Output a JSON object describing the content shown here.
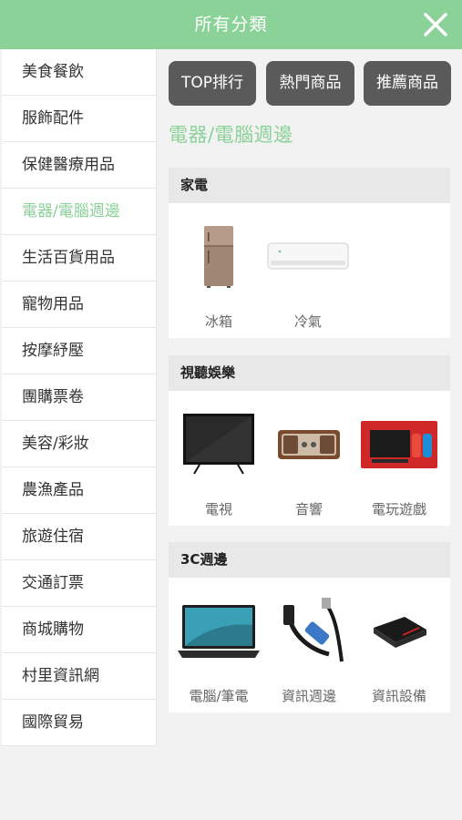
{
  "header": {
    "title": "所有分類",
    "close_icon": "close-icon"
  },
  "sidebar": {
    "items": [
      {
        "label": "美食餐飲"
      },
      {
        "label": "服飾配件"
      },
      {
        "label": "保健醫療用品"
      },
      {
        "label": "電器/電腦週邊",
        "active": true
      },
      {
        "label": "生活百貨用品"
      },
      {
        "label": "寵物用品"
      },
      {
        "label": "按摩紓壓"
      },
      {
        "label": "團購票卷"
      },
      {
        "label": "美容/彩妝"
      },
      {
        "label": "農漁產品"
      },
      {
        "label": "旅遊住宿"
      },
      {
        "label": "交通訂票"
      },
      {
        "label": "商城購物"
      },
      {
        "label": "村里資訊網"
      },
      {
        "label": "國際貿易"
      }
    ]
  },
  "tabs": [
    {
      "label": "TOP排行"
    },
    {
      "label": "熱門商品"
    },
    {
      "label": "推薦商品"
    }
  ],
  "section_title": "電器/電腦週邊",
  "groups": [
    {
      "title": "家電",
      "products": [
        {
          "label": "冰箱",
          "icon": "fridge-icon"
        },
        {
          "label": "冷氣",
          "icon": "air-conditioner-icon"
        }
      ]
    },
    {
      "title": "視聽娛樂",
      "products": [
        {
          "label": "電視",
          "icon": "tv-icon"
        },
        {
          "label": "音響",
          "icon": "speaker-icon"
        },
        {
          "label": "電玩遊戲",
          "icon": "game-console-icon"
        }
      ]
    },
    {
      "title": "3C週邊",
      "products": [
        {
          "label": "電腦/筆電",
          "icon": "laptop-icon"
        },
        {
          "label": "資訊週邊",
          "icon": "usb-cable-icon"
        },
        {
          "label": "資訊設備",
          "icon": "card-reader-icon"
        }
      ]
    }
  ],
  "colors": {
    "accent": "#8bd299",
    "tab_bg": "#5a5a5a",
    "panel_head_bg": "#e8e8e8"
  }
}
